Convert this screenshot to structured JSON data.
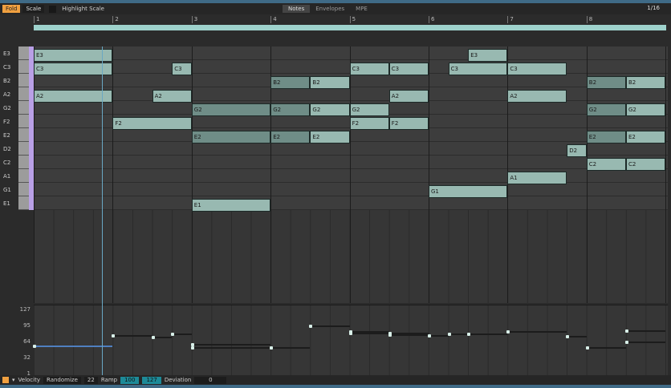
{
  "toolbar": {
    "fold": "Fold",
    "scale": "Scale",
    "highlight_scale": "Highlight Scale",
    "tabs": [
      "Notes",
      "Envelopes",
      "MPE"
    ],
    "grid": "1/16"
  },
  "ruler": [
    "1",
    "2",
    "3",
    "4",
    "5",
    "6",
    "7",
    "8"
  ],
  "keys": [
    "E3",
    "C3",
    "B2",
    "A2",
    "G2",
    "F2",
    "E2",
    "D2",
    "C2",
    "A1",
    "G1",
    "E1"
  ],
  "notes": [
    {
      "p": "E3",
      "s": 0,
      "l": 4
    },
    {
      "p": "E3",
      "s": 22,
      "l": 2
    },
    {
      "p": "C3",
      "s": 0,
      "l": 4
    },
    {
      "p": "C3",
      "s": 7,
      "l": 1
    },
    {
      "p": "C3",
      "s": 16,
      "l": 2
    },
    {
      "p": "C3",
      "s": 18,
      "l": 2
    },
    {
      "p": "C3",
      "s": 21,
      "l": 3
    },
    {
      "p": "C3",
      "s": 24,
      "l": 3
    },
    {
      "p": "B2",
      "s": 12,
      "l": 2,
      "d": 1
    },
    {
      "p": "B2",
      "s": 14,
      "l": 2
    },
    {
      "p": "B2",
      "s": 28,
      "l": 2,
      "d": 1
    },
    {
      "p": "B2",
      "s": 30,
      "l": 2
    },
    {
      "p": "A2",
      "s": 0,
      "l": 4
    },
    {
      "p": "A2",
      "s": 6,
      "l": 2
    },
    {
      "p": "A2",
      "s": 18,
      "l": 2
    },
    {
      "p": "A2",
      "s": 24,
      "l": 3
    },
    {
      "p": "G2",
      "s": 8,
      "l": 4,
      "d": 1
    },
    {
      "p": "G2",
      "s": 12,
      "l": 2,
      "d": 1
    },
    {
      "p": "G2",
      "s": 14,
      "l": 2
    },
    {
      "p": "G2",
      "s": 16,
      "l": 2
    },
    {
      "p": "G2",
      "s": 28,
      "l": 2,
      "d": 1
    },
    {
      "p": "G2",
      "s": 30,
      "l": 2
    },
    {
      "p": "F2",
      "s": 4,
      "l": 4
    },
    {
      "p": "F2",
      "s": 16,
      "l": 2
    },
    {
      "p": "F2",
      "s": 18,
      "l": 2
    },
    {
      "p": "E2",
      "s": 8,
      "l": 4,
      "d": 1
    },
    {
      "p": "E2",
      "s": 12,
      "l": 2,
      "d": 1
    },
    {
      "p": "E2",
      "s": 14,
      "l": 2
    },
    {
      "p": "E2",
      "s": 28,
      "l": 2,
      "d": 1
    },
    {
      "p": "E2",
      "s": 30,
      "l": 2
    },
    {
      "p": "D2",
      "s": 27,
      "l": 1
    },
    {
      "p": "C2",
      "s": 28,
      "l": 2
    },
    {
      "p": "C2",
      "s": 30,
      "l": 2
    },
    {
      "p": "A1",
      "s": 24,
      "l": 3
    },
    {
      "p": "G1",
      "s": 20,
      "l": 4
    },
    {
      "p": "E1",
      "s": 8,
      "l": 4
    }
  ],
  "velocity": {
    "ticks": [
      "127",
      "95",
      "64",
      "32",
      "1"
    ],
    "points": [
      {
        "s": 0,
        "l": 4,
        "v": 58
      },
      {
        "s": 4,
        "l": 2,
        "v": 78
      },
      {
        "s": 6,
        "l": 1,
        "v": 75
      },
      {
        "s": 7,
        "l": 1,
        "v": 82
      },
      {
        "s": 8,
        "l": 4,
        "v": 61
      },
      {
        "s": 8,
        "l": 4,
        "v": 55
      },
      {
        "s": 12,
        "l": 2,
        "v": 55
      },
      {
        "s": 14,
        "l": 2,
        "v": 97
      },
      {
        "s": 16,
        "l": 2,
        "v": 86
      },
      {
        "s": 16,
        "l": 2,
        "v": 83
      },
      {
        "s": 18,
        "l": 2,
        "v": 83
      },
      {
        "s": 18,
        "l": 2,
        "v": 80
      },
      {
        "s": 20,
        "l": 1,
        "v": 78
      },
      {
        "s": 21,
        "l": 1,
        "v": 81
      },
      {
        "s": 22,
        "l": 2,
        "v": 81
      },
      {
        "s": 24,
        "l": 3,
        "v": 86
      },
      {
        "s": 27,
        "l": 1,
        "v": 76
      },
      {
        "s": 28,
        "l": 2,
        "v": 55
      },
      {
        "s": 30,
        "l": 2,
        "v": 88
      },
      {
        "s": 30,
        "l": 2,
        "v": 66
      }
    ]
  },
  "bottom": {
    "velocity": "Velocity",
    "randomize": "Randomize",
    "rand_value": "22",
    "ramp": "Ramp",
    "ramp_start": "100",
    "ramp_end": "127",
    "deviation": "Deviation",
    "deviation_value": "0"
  }
}
